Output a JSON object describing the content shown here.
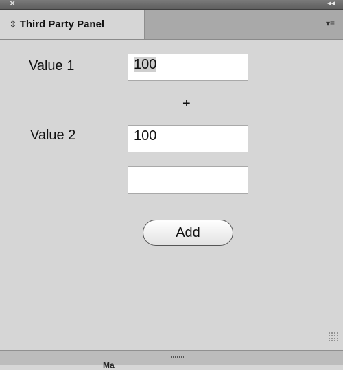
{
  "window": {
    "close_glyph": "✕",
    "collapse_glyph": "◂◂"
  },
  "panel": {
    "tab_arrow": "⇕",
    "tab_title": "Third Party Panel",
    "menu_glyph": "▾≡"
  },
  "form": {
    "value1_label": "Value 1",
    "value1": "100",
    "operator": "+",
    "value2_label": "Value 2",
    "value2": "100",
    "result": "",
    "add_button": "Add"
  },
  "bottom_bar": {
    "fragment": "Ma"
  }
}
